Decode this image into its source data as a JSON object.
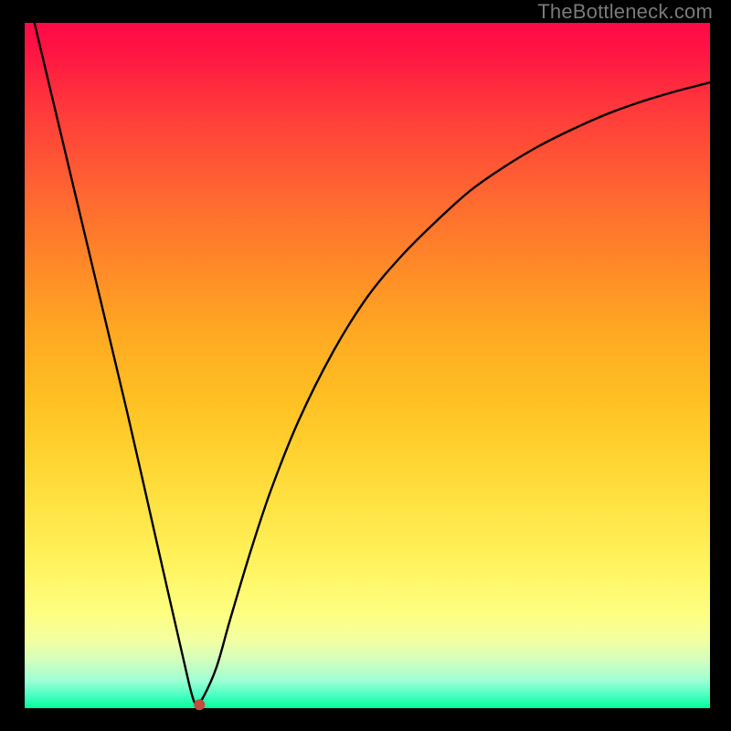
{
  "watermark": "TheBottleneck.com",
  "chart_data": {
    "type": "line",
    "title": "",
    "xlabel": "",
    "ylabel": "",
    "xlim": [
      0,
      100
    ],
    "ylim": [
      0,
      100
    ],
    "marker": {
      "x": 25.5,
      "y": 0.5,
      "color": "#c24b3f",
      "radius_px": 6
    },
    "series": [
      {
        "name": "bottleneck-curve",
        "x": [
          0,
          5,
          10,
          15,
          20,
          24,
          25,
          26,
          28,
          30,
          33,
          36,
          40,
          45,
          50,
          55,
          60,
          65,
          70,
          75,
          80,
          85,
          90,
          95,
          100
        ],
        "y": [
          106,
          85,
          64,
          43,
          21,
          3.5,
          0.5,
          1.5,
          6,
          13,
          23,
          32,
          42,
          52,
          60,
          66,
          71,
          75.5,
          79,
          82,
          84.5,
          86.7,
          88.5,
          90,
          91.3
        ]
      },
      {
        "name": "left-branch",
        "x": [
          0,
          24.5
        ],
        "y": [
          106,
          2
        ]
      },
      {
        "name": "right-branch-asymptote",
        "x": [
          26,
          100
        ],
        "y": [
          1.5,
          91.3
        ]
      }
    ],
    "grid": false,
    "legend": false
  }
}
